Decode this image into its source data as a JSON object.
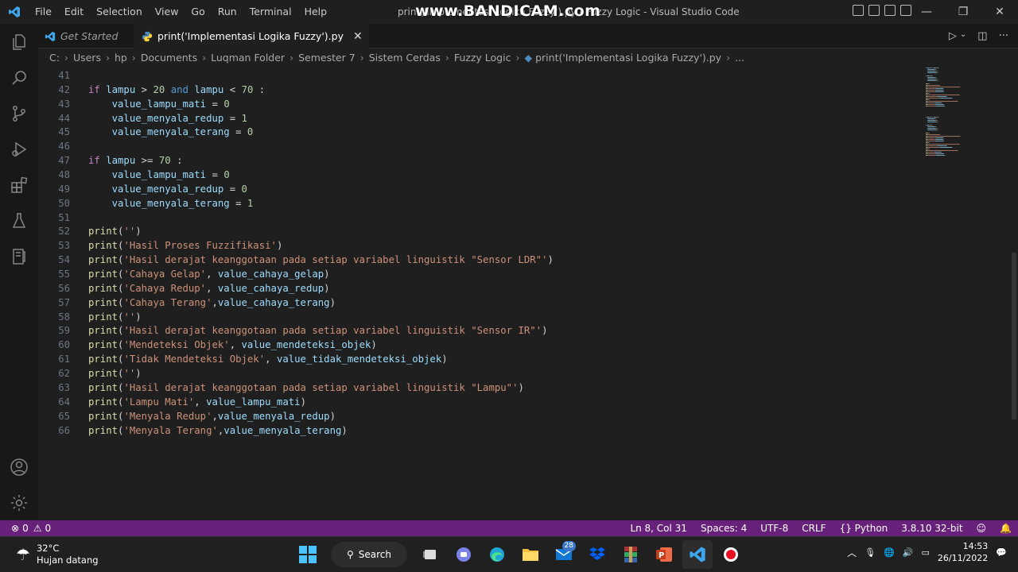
{
  "titlebar": {
    "menu": [
      "File",
      "Edit",
      "Selection",
      "View",
      "Go",
      "Run",
      "Terminal",
      "Help"
    ],
    "window_title": "print('Implementasi Logika Fuzzy').py - Fuzzy Logic - Visual Studio Code",
    "watermark": "www.BANDICAM.com"
  },
  "tabs": [
    {
      "label": "Get Started",
      "active": false
    },
    {
      "label": "print('Implementasi Logika Fuzzy').py",
      "active": true
    }
  ],
  "breadcrumb": [
    "C:",
    "Users",
    "hp",
    "Documents",
    "Luqman Folder",
    "Semester 7",
    "Sistem Cerdas",
    "Fuzzy Logic",
    "print('Implementasi Logika Fuzzy').py",
    "..."
  ],
  "editor": {
    "lines": [
      {
        "n": "41",
        "t": []
      },
      {
        "n": "42",
        "t": [
          [
            "ctl",
            "if"
          ],
          [
            "op",
            " "
          ],
          [
            "vr",
            "lampu"
          ],
          [
            "op",
            " > "
          ],
          [
            "nm",
            "20"
          ],
          [
            "op",
            " "
          ],
          [
            "kw",
            "and"
          ],
          [
            "op",
            " "
          ],
          [
            "vr",
            "lampu"
          ],
          [
            "op",
            " < "
          ],
          [
            "nm",
            "70"
          ],
          [
            "op",
            " :"
          ]
        ]
      },
      {
        "n": "43",
        "t": [
          [
            "op",
            "    "
          ],
          [
            "vr",
            "value_lampu_mati"
          ],
          [
            "op",
            " = "
          ],
          [
            "nm",
            "0"
          ]
        ]
      },
      {
        "n": "44",
        "t": [
          [
            "op",
            "    "
          ],
          [
            "vr",
            "value_menyala_redup"
          ],
          [
            "op",
            " = "
          ],
          [
            "nm",
            "1"
          ]
        ]
      },
      {
        "n": "45",
        "t": [
          [
            "op",
            "    "
          ],
          [
            "vr",
            "value_menyala_terang"
          ],
          [
            "op",
            " = "
          ],
          [
            "nm",
            "0"
          ]
        ]
      },
      {
        "n": "46",
        "t": []
      },
      {
        "n": "47",
        "t": [
          [
            "ctl",
            "if"
          ],
          [
            "op",
            " "
          ],
          [
            "vr",
            "lampu"
          ],
          [
            "op",
            " >= "
          ],
          [
            "nm",
            "70"
          ],
          [
            "op",
            " :"
          ]
        ]
      },
      {
        "n": "48",
        "t": [
          [
            "op",
            "    "
          ],
          [
            "vr",
            "value_lampu_mati"
          ],
          [
            "op",
            " = "
          ],
          [
            "nm",
            "0"
          ]
        ]
      },
      {
        "n": "49",
        "t": [
          [
            "op",
            "    "
          ],
          [
            "vr",
            "value_menyala_redup"
          ],
          [
            "op",
            " = "
          ],
          [
            "nm",
            "0"
          ]
        ]
      },
      {
        "n": "50",
        "t": [
          [
            "op",
            "    "
          ],
          [
            "vr",
            "value_menyala_terang"
          ],
          [
            "op",
            " = "
          ],
          [
            "nm",
            "1"
          ]
        ]
      },
      {
        "n": "51",
        "t": []
      },
      {
        "n": "52",
        "t": [
          [
            "fn",
            "print"
          ],
          [
            "op",
            "("
          ],
          [
            "st",
            "''"
          ],
          [
            "op",
            ")"
          ]
        ]
      },
      {
        "n": "53",
        "t": [
          [
            "fn",
            "print"
          ],
          [
            "op",
            "("
          ],
          [
            "st",
            "'Hasil Proses Fuzzifikasi'"
          ],
          [
            "op",
            ")"
          ]
        ]
      },
      {
        "n": "54",
        "t": [
          [
            "fn",
            "print"
          ],
          [
            "op",
            "("
          ],
          [
            "st",
            "'Hasil derajat keanggotaan pada setiap variabel linguistik \"Sensor LDR\"'"
          ],
          [
            "op",
            ")"
          ]
        ]
      },
      {
        "n": "55",
        "t": [
          [
            "fn",
            "print"
          ],
          [
            "op",
            "("
          ],
          [
            "st",
            "'Cahaya Gelap'"
          ],
          [
            "op",
            ", "
          ],
          [
            "vr",
            "value_cahaya_gelap"
          ],
          [
            "op",
            ")"
          ]
        ]
      },
      {
        "n": "56",
        "t": [
          [
            "fn",
            "print"
          ],
          [
            "op",
            "("
          ],
          [
            "st",
            "'Cahaya Redup'"
          ],
          [
            "op",
            ", "
          ],
          [
            "vr",
            "value_cahaya_redup"
          ],
          [
            "op",
            ")"
          ]
        ]
      },
      {
        "n": "57",
        "t": [
          [
            "fn",
            "print"
          ],
          [
            "op",
            "("
          ],
          [
            "st",
            "'Cahaya Terang'"
          ],
          [
            "op",
            ","
          ],
          [
            "vr",
            "value_cahaya_terang"
          ],
          [
            "op",
            ")"
          ]
        ]
      },
      {
        "n": "58",
        "t": [
          [
            "fn",
            "print"
          ],
          [
            "op",
            "("
          ],
          [
            "st",
            "''"
          ],
          [
            "op",
            ")"
          ]
        ]
      },
      {
        "n": "59",
        "t": [
          [
            "fn",
            "print"
          ],
          [
            "op",
            "("
          ],
          [
            "st",
            "'Hasil derajat keanggotaan pada setiap variabel linguistik \"Sensor IR\"'"
          ],
          [
            "op",
            ")"
          ]
        ]
      },
      {
        "n": "60",
        "t": [
          [
            "fn",
            "print"
          ],
          [
            "op",
            "("
          ],
          [
            "st",
            "'Mendeteksi Objek'"
          ],
          [
            "op",
            ", "
          ],
          [
            "vr",
            "value_mendeteksi_objek"
          ],
          [
            "op",
            ")"
          ]
        ]
      },
      {
        "n": "61",
        "t": [
          [
            "fn",
            "print"
          ],
          [
            "op",
            "("
          ],
          [
            "st",
            "'Tidak Mendeteksi Objek'"
          ],
          [
            "op",
            ", "
          ],
          [
            "vr",
            "value_tidak_mendeteksi_objek"
          ],
          [
            "op",
            ")"
          ]
        ]
      },
      {
        "n": "62",
        "t": [
          [
            "fn",
            "print"
          ],
          [
            "op",
            "("
          ],
          [
            "st",
            "''"
          ],
          [
            "op",
            ")"
          ]
        ]
      },
      {
        "n": "63",
        "t": [
          [
            "fn",
            "print"
          ],
          [
            "op",
            "("
          ],
          [
            "st",
            "'Hasil derajat keanggotaan pada setiap variabel linguistik \"Lampu\"'"
          ],
          [
            "op",
            ")"
          ]
        ]
      },
      {
        "n": "64",
        "t": [
          [
            "fn",
            "print"
          ],
          [
            "op",
            "("
          ],
          [
            "st",
            "'Lampu Mati'"
          ],
          [
            "op",
            ", "
          ],
          [
            "vr",
            "value_lampu_mati"
          ],
          [
            "op",
            ")"
          ]
        ]
      },
      {
        "n": "65",
        "t": [
          [
            "fn",
            "print"
          ],
          [
            "op",
            "("
          ],
          [
            "st",
            "'Menyala Redup'"
          ],
          [
            "op",
            ","
          ],
          [
            "vr",
            "value_menyala_redup"
          ],
          [
            "op",
            ")"
          ]
        ]
      },
      {
        "n": "66",
        "t": [
          [
            "fn",
            "print"
          ],
          [
            "op",
            "("
          ],
          [
            "st",
            "'Menyala Terang'"
          ],
          [
            "op",
            ","
          ],
          [
            "vr",
            "value_menyala_terang"
          ],
          [
            "op",
            ")"
          ]
        ]
      }
    ]
  },
  "statusbar": {
    "errors": "0",
    "warnings": "0",
    "position": "Ln 8, Col 31",
    "spaces": "Spaces: 4",
    "encoding": "UTF-8",
    "eol": "CRLF",
    "language": "Python",
    "interpreter": "3.8.10 32-bit",
    "color": "#68217a"
  },
  "taskbar": {
    "temperature": "32°C",
    "weather": "Hujan datang",
    "search_label": "Search",
    "mail_badge": "28",
    "time": "14:53",
    "date": "26/11/2022"
  }
}
